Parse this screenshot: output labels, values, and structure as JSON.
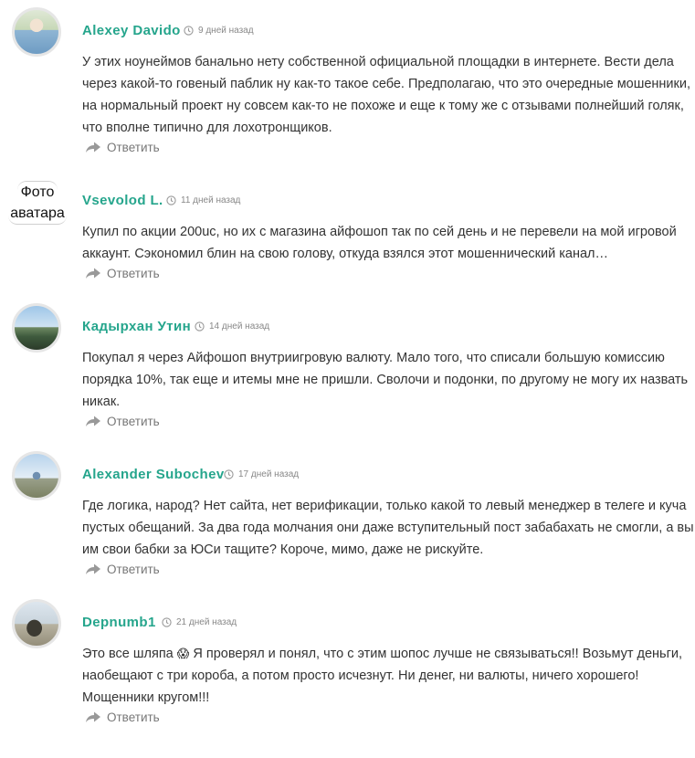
{
  "comments": [
    {
      "author": "Alexey Davido",
      "date": "9 дней назад",
      "avatar": "photo",
      "text": "У этих ноунеймов банально нету собственной официальной площадки в интернете. Вести дела через какой-то говеный паблик ну как-то такое себе. Предполагаю, что это очередные мошенники, на нормальный проект ну совсем как-то не похоже и еще к тому же с отзывами полнейший голяк, что вполне типично для лохотронщиков.",
      "reply_label": "Ответить"
    },
    {
      "author": "Vsevolod L.",
      "date": "11 дней назад",
      "avatar": "placeholder",
      "avatar_text_1": "Фото",
      "avatar_text_2": "аватара",
      "text": "Купил по акции 200uc, но их с магазина айфошоп так по сей день и не перевели на мой игровой аккаунт. Сэкономил блин на свою голову, откуда взялся этот мошеннический канал…",
      "reply_label": "Ответить"
    },
    {
      "author": "Кадырхан Утин",
      "date": "14 дней назад",
      "avatar": "photo",
      "text": "Покупал я через Айфошоп внутриигровую валюту. Мало того, что списали большую комиссию порядка 10%, так еще и итемы мне не пришли. Сволочи и подонки, по другому не могу их назвать никак.",
      "reply_label": "Ответить"
    },
    {
      "author": "Alexander Subochev",
      "date": "17 дней назад",
      "avatar": "photo",
      "text": "Где логика, народ? Нет сайта, нет верификации, только какой то левый менеджер в телеге и куча пустых обещаний. За два года молчания они даже вступительный пост забабахать не смогли, а вы им свои бабки за ЮСи тащите? Короче, мимо, даже не рискуйте.",
      "reply_label": "Ответить"
    },
    {
      "author": "Depnumb1",
      "date": "21 дней назад",
      "avatar": "photo",
      "text_before_emoji": "Это все шляпа ",
      "emoji": "😱",
      "text_after_emoji": " Я проверял и понял, что с этим шопос лучше не связываться!! Возьмут деньги, наобещают с три короба, а потом просто исчезнут. Ни денег, ни валюты, ничего хорошего! Мощенники кругом!!!",
      "reply_label": "Ответить"
    }
  ],
  "colors": {
    "author": "#25a58c",
    "text": "#333333",
    "meta": "#888888",
    "reply": "#777777"
  },
  "icons": {
    "date": "clock-icon",
    "reply": "reply-arrow-icon"
  }
}
